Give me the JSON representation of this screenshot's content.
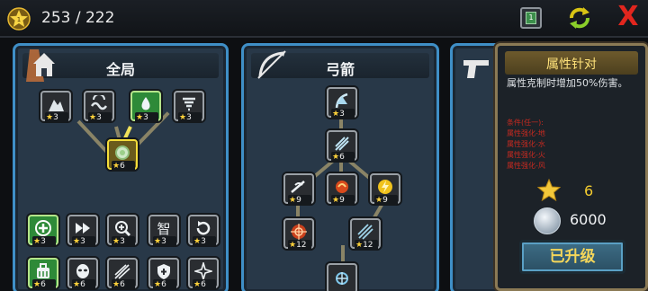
{
  "topbar": {
    "star_badge_level": "1",
    "star_count": "253 / 222",
    "notify_count": "1",
    "close_label": "X"
  },
  "panels": [
    {
      "title": "全局",
      "icon": "home-icon"
    },
    {
      "title": "弓箭",
      "icon": "bow-icon"
    },
    {
      "title": "",
      "icon": "pistol-icon"
    }
  ],
  "nodes": {
    "global": [
      {
        "icon": "mountain-icon",
        "cost": "3"
      },
      {
        "icon": "wave-icon",
        "cost": "3"
      },
      {
        "icon": "water-drop-icon",
        "cost": "3"
      },
      {
        "icon": "tornado-icon",
        "cost": "3"
      },
      {
        "icon": "orb-icon",
        "cost": "6"
      },
      {
        "icon": "add-circle-icon",
        "cost": "3"
      },
      {
        "icon": "fast-forward-icon",
        "cost": "3"
      },
      {
        "icon": "zoom-in-icon",
        "cost": "3"
      },
      {
        "icon": "wisdom-icon",
        "cost": "3"
      },
      {
        "icon": "cycle-icon",
        "cost": "3"
      },
      {
        "icon": "backpack-icon",
        "cost": "6"
      },
      {
        "icon": "mask-icon",
        "cost": "6"
      },
      {
        "icon": "arrows-icon",
        "cost": "6"
      },
      {
        "icon": "shield-heal-icon",
        "cost": "6"
      },
      {
        "icon": "star-burst-icon",
        "cost": "6"
      }
    ],
    "bow": [
      {
        "icon": "bow-ice-icon",
        "cost": "3"
      },
      {
        "icon": "bow-frost-icon",
        "cost": "6"
      },
      {
        "icon": "bow-wind-icon",
        "cost": "9"
      },
      {
        "icon": "bow-fire-icon",
        "cost": "9"
      },
      {
        "icon": "bow-lightning-icon",
        "cost": "9"
      },
      {
        "icon": "target-icon",
        "cost": "12"
      },
      {
        "icon": "triple-arrow-icon",
        "cost": "12"
      },
      {
        "icon": "snowflake-icon",
        "cost": ""
      }
    ]
  },
  "info": {
    "title": "属性针对",
    "desc": "属性克制时增加50%伤害。",
    "conditions": [
      "条件(任一):",
      "属性强化-地",
      "属性强化-水",
      "属性强化-火",
      "属性强化-风"
    ],
    "star_cost": "6",
    "coin_cost": "6000",
    "upgrade_label": "已升级"
  },
  "colors": {
    "panel_border": "#3f8fc7",
    "active_link": "#f0e15a",
    "green_node": "#2e8a38",
    "gold_node": "#f4dd3a",
    "warning_red": "#c62a20",
    "close_red": "#e2261e"
  }
}
